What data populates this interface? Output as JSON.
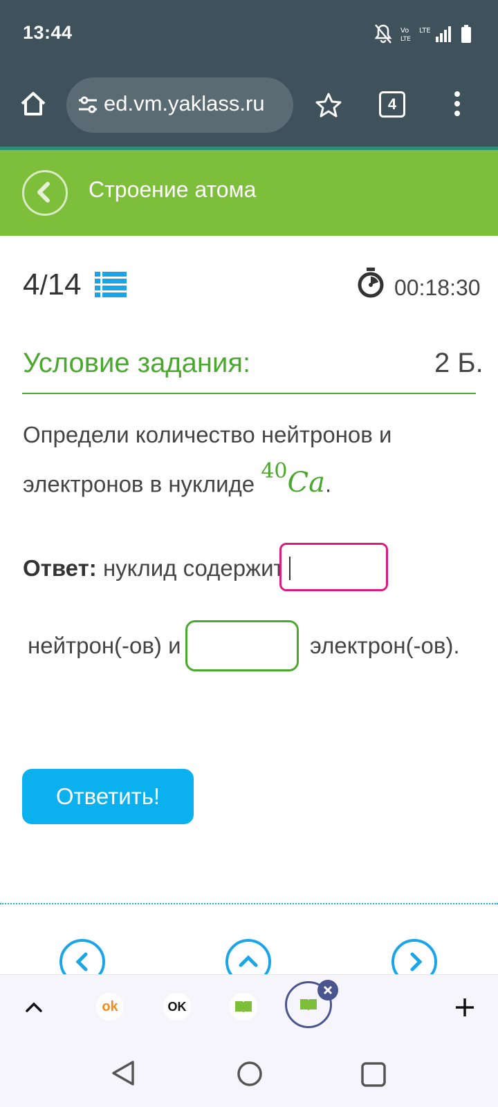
{
  "status_bar": {
    "time": "13:44"
  },
  "browser": {
    "url": "ed.vm.yaklass.ru",
    "tab_count": "4"
  },
  "header": {
    "title": "Строение атома"
  },
  "progress": {
    "current": "4",
    "total": "14",
    "timer": "00:18:30"
  },
  "task": {
    "title": "Условие задания:",
    "points": "2 Б.",
    "question_line1": "Определи количество нейтронов и",
    "question_line2": "электронов в нуклиде",
    "nuclide_mass": "40",
    "nuclide_symbol": "Ca",
    "question_end": "."
  },
  "answer": {
    "label": "Ответ:",
    "text_before": "нуклид содержит",
    "neutron_value": "",
    "text_middle": "нейтрон(-ов) и",
    "electron_value": "",
    "text_after": "электрон(-ов)."
  },
  "submit_button": {
    "label": "Ответить!"
  },
  "bottom_tabs": [
    {
      "name": "odnoklassniki",
      "label": "ok"
    },
    {
      "name": "ok",
      "label": "OK"
    }
  ],
  "colors": {
    "accent_green": "#7dbf3b",
    "title_green": "#4aa82e",
    "button_blue": "#0bb1ef",
    "input_magenta": "#d91c7e"
  }
}
